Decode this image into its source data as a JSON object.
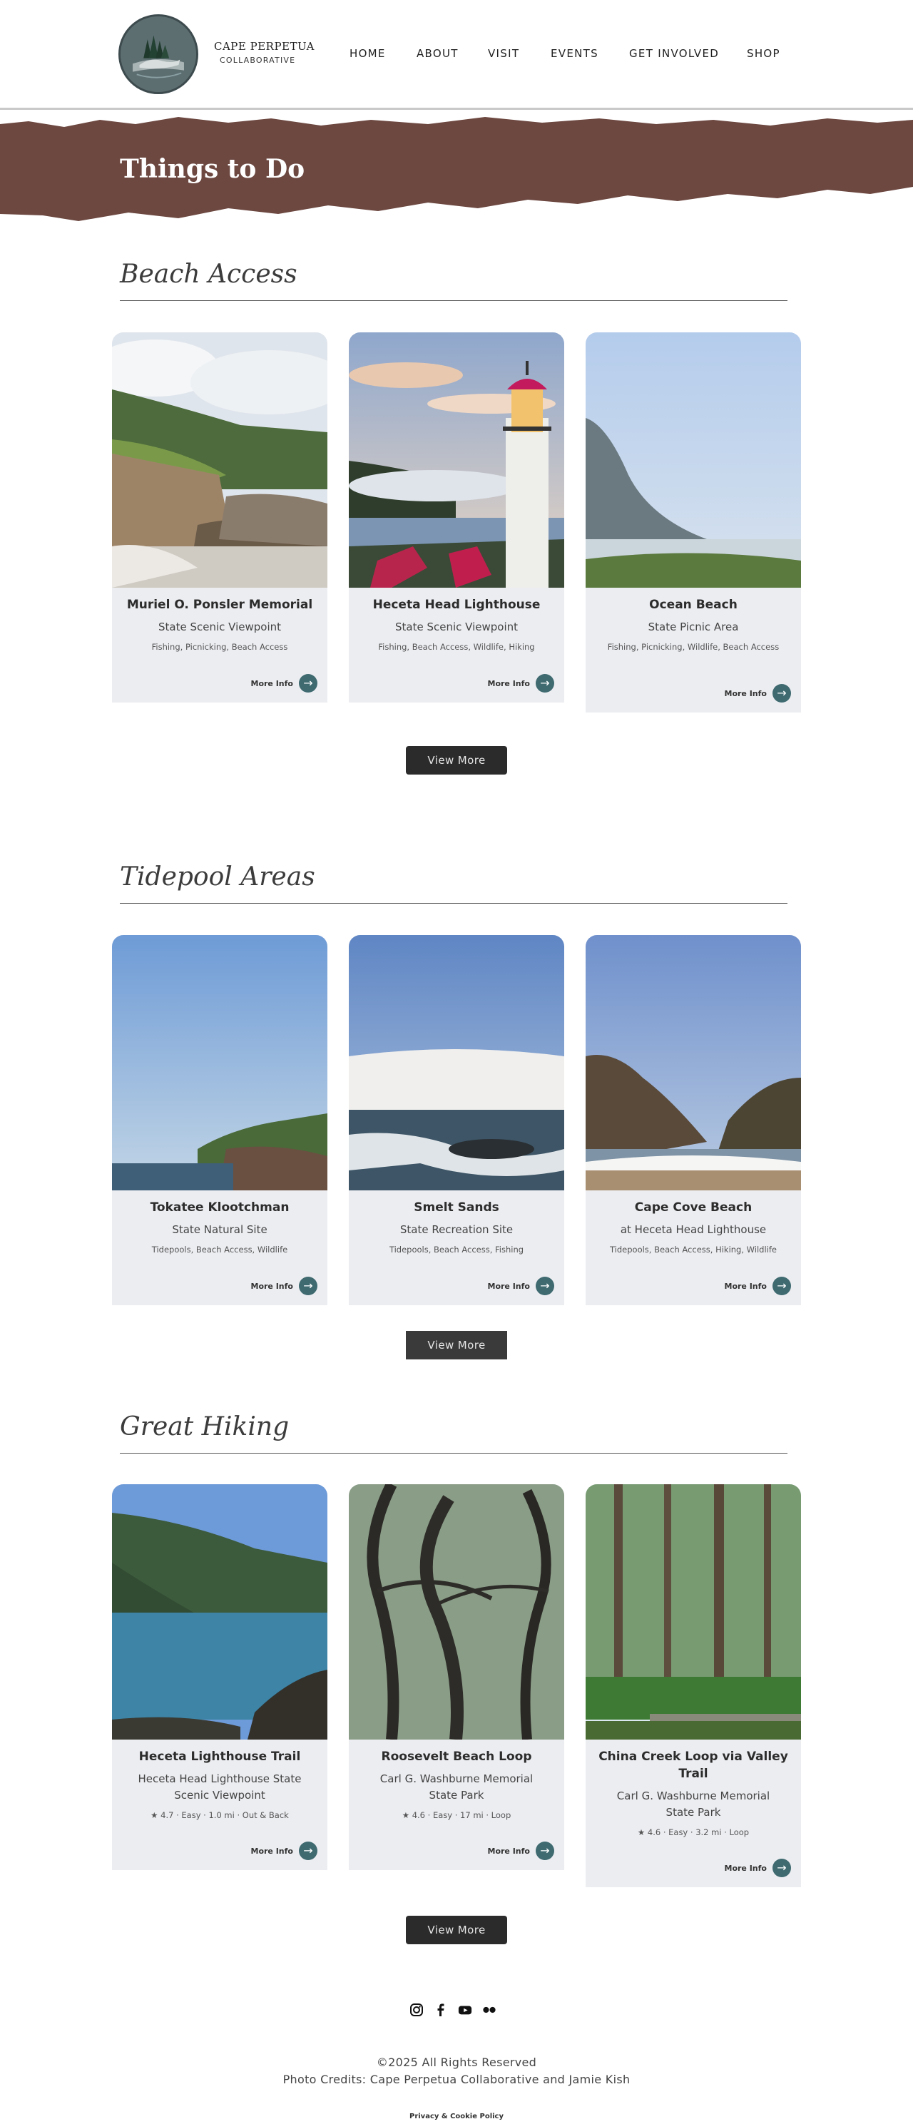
{
  "header": {
    "brand_title": "CAPE PERPETUA",
    "brand_sub": "COLLABORATIVE",
    "nav": [
      "HOME",
      "ABOUT",
      "VISIT",
      "EVENTS",
      "GET INVOLVED",
      "SHOP"
    ]
  },
  "banner": {
    "title": "Things to Do"
  },
  "sections": [
    {
      "title": "Beach Access",
      "cards": [
        {
          "title": "Muriel O. Ponsler Memorial",
          "sub": "State Scenic Viewpoint",
          "tags": "Fishing, Picnicking, Beach Access",
          "more": "More Info"
        },
        {
          "title": "Heceta Head Lighthouse",
          "sub": "State Scenic Viewpoint",
          "tags": "Fishing, Beach Access, Wildlife, Hiking",
          "more": "More Info"
        },
        {
          "title": "Ocean Beach",
          "sub": "State Picnic Area",
          "tags": "Fishing, Picnicking, Wildlife, Beach Access",
          "more": "More Info"
        }
      ],
      "view_more": "View More"
    },
    {
      "title": "Tidepool Areas",
      "cards": [
        {
          "title": "Tokatee Klootchman",
          "sub": "State Natural Site",
          "tags": "Tidepools, Beach Access, Wildlife",
          "more": "More Info"
        },
        {
          "title": "Smelt Sands",
          "sub": "State Recreation Site",
          "tags": "Tidepools, Beach Access, Fishing",
          "more": "More Info"
        },
        {
          "title": "Cape Cove Beach",
          "sub": "at Heceta Head Lighthouse",
          "tags": "Tidepools, Beach Access, Hiking, Wildlife",
          "more": "More Info"
        }
      ],
      "view_more": "View More"
    },
    {
      "title": "Great Hiking",
      "cards": [
        {
          "title": "Heceta Lighthouse Trail",
          "sub": "Heceta Head Lighthouse State Scenic Viewpoint",
          "tags": "★ 4.7 · Easy · 1.0 mi · Out & Back",
          "more": "More Info"
        },
        {
          "title": "Roosevelt Beach Loop",
          "sub": "Carl G. Washburne Memorial State Park",
          "tags": "★ 4.6 · Easy · 17 mi · Loop",
          "more": "More Info"
        },
        {
          "title": "China Creek Loop via Valley Trail",
          "sub": "Carl G. Washburne Memorial State Park",
          "tags": "★ 4.6 · Easy · 3.2 mi · Loop",
          "more": "More Info"
        }
      ],
      "view_more": "View More"
    }
  ],
  "footer": {
    "social": [
      "instagram-icon",
      "facebook-icon",
      "youtube-icon",
      "flickr-icon"
    ],
    "copyright": "©2025 All Rights Reserved",
    "credits": "Photo Credits: Cape Perpetua Collaborative and Jamie Kish",
    "policy": "Privacy & Cookie Policy"
  },
  "colors": {
    "banner": "#6d4841",
    "accent": "#3e6a70",
    "card_bg": "#ecedf1",
    "button": "#2b2b2b"
  }
}
